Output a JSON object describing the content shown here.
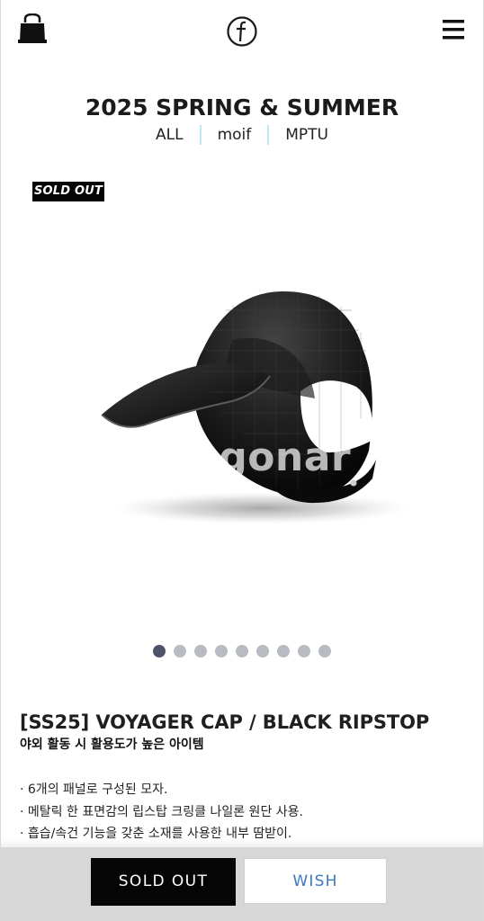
{
  "header": {
    "cart_icon": "shopping-bag-icon",
    "logo_icon": "f-circle-logo",
    "menu_icon": "hamburger-menu-icon"
  },
  "collection": {
    "title": "2025 SPRING & SUMMER",
    "tabs": [
      {
        "label": "ALL"
      },
      {
        "label": "moif"
      },
      {
        "label": "MPTU"
      }
    ]
  },
  "product": {
    "badge": "SOLD OUT",
    "watermark": "agonar",
    "image_count": 9,
    "active_image_index": 0,
    "name": "[SS25] VOYAGER CAP / BLACK RIPSTOP",
    "tagline": "야외 활동 시 활용도가 높은 아이템",
    "features": [
      "· 6개의 패널로 구성된 모자.",
      "· 메탈릭 한 표면감의 립스탑 크링클 나일론 원단 사용.",
      "· 흡습/속건 기능을 갖춘 소재를 사용한 내부 땀받이."
    ]
  },
  "actions": {
    "soldout_label": "SOLD OUT",
    "wish_label": "WISH"
  },
  "colors": {
    "divider": "#bde7f3",
    "active_dot": "#4d5369",
    "inactive_dot": "#b8bcc2",
    "wish_text": "#3c79c0",
    "footer_background": "#d7d7d7"
  }
}
